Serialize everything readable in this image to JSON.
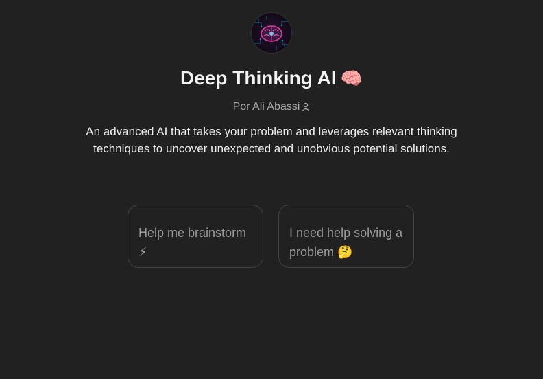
{
  "gpt": {
    "avatar_icon": "brain-circuit-icon",
    "title": "Deep Thinking AI",
    "title_emoji": "🧠",
    "author_prefix": "Por",
    "author_name": "Ali Abassi",
    "author_icon": "user-icon",
    "description": "An advanced AI that takes your problem and leverages relevant thinking techniques to uncover unexpected and unobvious potential solutions."
  },
  "conversation_starters": [
    {
      "text": "Help me brainstorm",
      "emoji": "⚡"
    },
    {
      "text": "I need help solving a problem",
      "emoji": "🤔"
    }
  ],
  "colors": {
    "background": "#212121",
    "text": "#ececec",
    "muted": "#9b9b9b",
    "border": "#424242",
    "avatar_accent": "#e0409a"
  }
}
